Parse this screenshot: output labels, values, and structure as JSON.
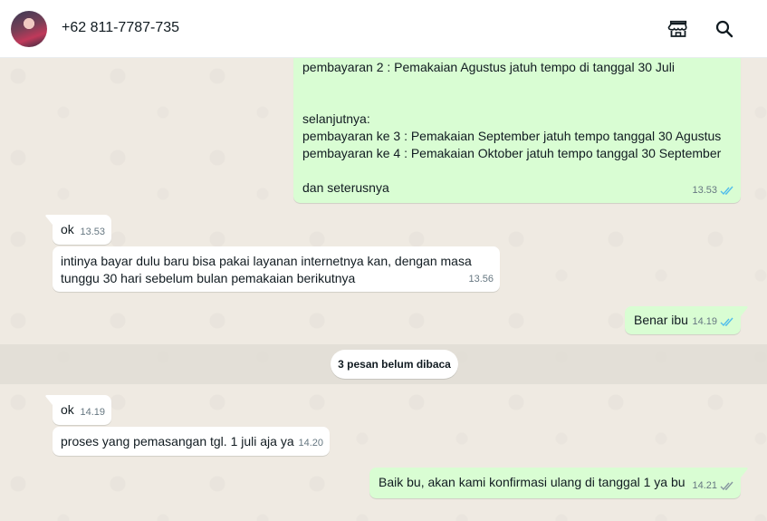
{
  "header": {
    "contact_name": "+62 811-7787-735",
    "icons": [
      "store-icon",
      "search-icon"
    ]
  },
  "messages": [
    {
      "direction": "out",
      "text": "pembayaran 2 : Pemakaian Agustus jatuh tempo di tanggal 30 Juli\n\n\nselanjutnya:\npembayaran ke 3 : Pemakaian September jatuh tempo tanggal 30 Agustus\npembayaran ke 4 : Pemakaian Oktober jatuh tempo tanggal 30 September\n\ndan seterusnya",
      "time": "13.53",
      "status": "read"
    },
    {
      "direction": "in",
      "text": "ok",
      "time": "13.53"
    },
    {
      "direction": "in",
      "text": "intinya bayar dulu baru bisa pakai layanan internetnya kan, dengan masa\ntunggu 30 hari sebelum bulan pemakaian berikutnya",
      "time": "13.56"
    },
    {
      "direction": "out",
      "text": "Benar ibu",
      "time": "14.19",
      "status": "read"
    },
    {
      "direction": "in",
      "text": "ok",
      "time": "14.19"
    },
    {
      "direction": "in",
      "text": "proses yang pemasangan tgl. 1 juli aja ya",
      "time": "14.20"
    },
    {
      "direction": "out",
      "text": "Baik bu, akan kami konfirmasi ulang di tanggal 1 ya bu",
      "time": "14.21",
      "status": "delivered"
    }
  ],
  "unread_divider": "3 pesan belum dibaca",
  "colors": {
    "header_bg": "#ffffff",
    "chat_bg": "#efeae2",
    "incoming_bubble": "#ffffff",
    "outgoing_bubble": "#d9fdd3",
    "read_ticks": "#53bdeb",
    "delivered_ticks": "#8696a0"
  }
}
